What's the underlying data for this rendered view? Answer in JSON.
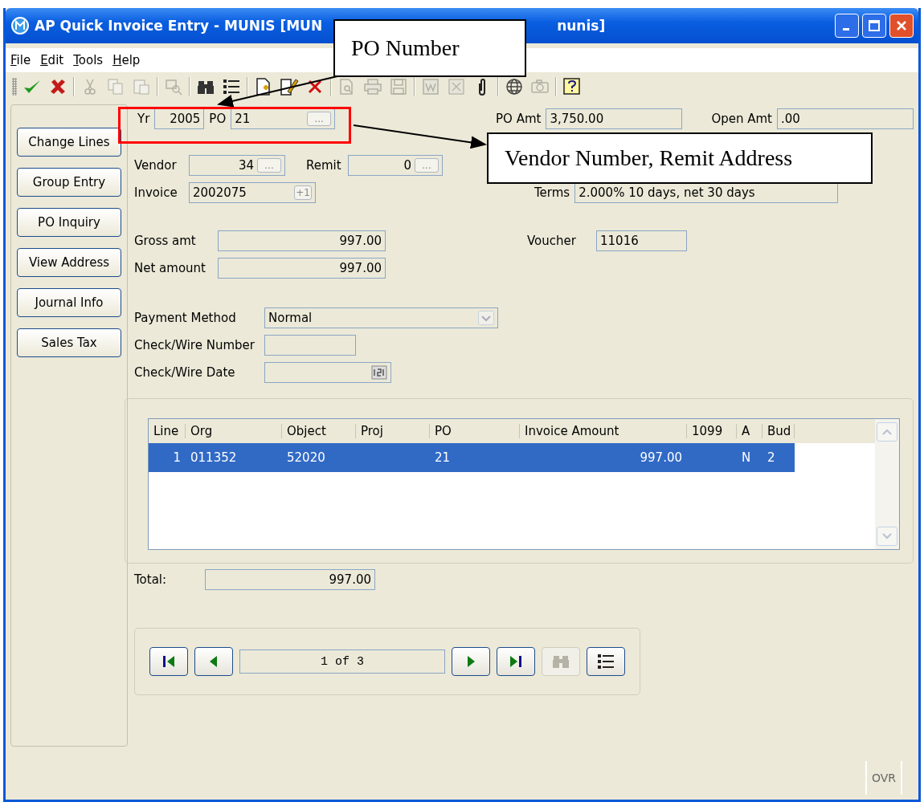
{
  "window": {
    "title_left": "AP Quick Invoice Entry - MUNIS [MUN",
    "title_right": "nunis]"
  },
  "menu": [
    "File",
    "Edit",
    "Tools",
    "Help"
  ],
  "toolbar": [
    {
      "kind": "accept",
      "disabled": false
    },
    {
      "kind": "cancel",
      "disabled": false
    },
    {
      "kind": "sep"
    },
    {
      "kind": "cut",
      "disabled": true
    },
    {
      "kind": "copy",
      "disabled": true
    },
    {
      "kind": "paste",
      "disabled": true
    },
    {
      "kind": "sep"
    },
    {
      "kind": "zoom",
      "disabled": true
    },
    {
      "kind": "sep"
    },
    {
      "kind": "find",
      "disabled": false
    },
    {
      "kind": "list",
      "disabled": false
    },
    {
      "kind": "sep"
    },
    {
      "kind": "new",
      "disabled": false
    },
    {
      "kind": "edit",
      "disabled": false
    },
    {
      "kind": "delete",
      "disabled": false
    },
    {
      "kind": "sep"
    },
    {
      "kind": "preview",
      "disabled": true
    },
    {
      "kind": "print",
      "disabled": true
    },
    {
      "kind": "save",
      "disabled": true
    },
    {
      "kind": "sep"
    },
    {
      "kind": "word",
      "disabled": true
    },
    {
      "kind": "excel",
      "disabled": true
    },
    {
      "kind": "attach",
      "disabled": false
    },
    {
      "kind": "sep"
    },
    {
      "kind": "globe",
      "disabled": false
    },
    {
      "kind": "camera",
      "disabled": true
    },
    {
      "kind": "sep"
    },
    {
      "kind": "help",
      "disabled": false
    }
  ],
  "side_buttons": [
    "Change Lines",
    "Group Entry",
    "PO Inquiry",
    "View Address",
    "Journal Info",
    "Sales Tax"
  ],
  "header": {
    "yr_label": "Yr",
    "yr": "2005",
    "po_label": "PO",
    "po": "21",
    "po_lookup": "...",
    "po_amt_label": "PO Amt",
    "po_amt": "3,750.00",
    "open_amt_label": "Open Amt",
    "open_amt": ".00"
  },
  "form": {
    "vendor_label": "Vendor",
    "vendor": "34",
    "vendor_lookup": "...",
    "remit_label": "Remit",
    "remit": "0",
    "remit_lookup": "...",
    "invoice_label": "Invoice",
    "invoice": "2002075",
    "invoice_btn": "+1",
    "terms_label": "Terms",
    "terms": "2.000% 10 days, net 30 days",
    "gross_label": "Gross amt",
    "gross": "997.00",
    "voucher_label": "Voucher",
    "voucher": "11016",
    "net_label": "Net amount",
    "net": "997.00",
    "payment_label": "Payment Method",
    "payment": "Normal",
    "check_number_label": "Check/Wire Number",
    "check_date_label": "Check/Wire Date"
  },
  "table": {
    "columns": [
      "Line",
      "Org",
      "Object",
      "Proj",
      "PO",
      "Invoice Amount",
      "1099",
      "A",
      "Bud"
    ],
    "rows": [
      {
        "selected": true,
        "cells": [
          "1",
          "011352",
          "52020",
          "",
          "21",
          "997.00",
          "",
          "N",
          "2"
        ]
      }
    ]
  },
  "total": {
    "label": "Total:",
    "value": "997.00"
  },
  "navigator": {
    "position": "1 of 3"
  },
  "status_bar": {
    "mode": "OVR"
  },
  "callouts": [
    {
      "text": "PO Number"
    },
    {
      "text": "Vendor Number, Remit Address"
    }
  ]
}
